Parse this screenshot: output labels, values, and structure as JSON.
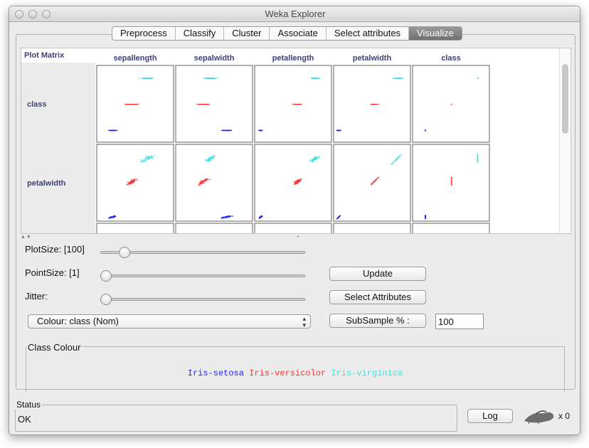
{
  "window": {
    "title": "Weka Explorer"
  },
  "tabs": [
    {
      "label": "Preprocess",
      "active": false
    },
    {
      "label": "Classify",
      "active": false
    },
    {
      "label": "Cluster",
      "active": false
    },
    {
      "label": "Associate",
      "active": false
    },
    {
      "label": "Select attributes",
      "active": false
    },
    {
      "label": "Visualize",
      "active": true
    }
  ],
  "plot_matrix": {
    "label": "Plot Matrix",
    "columns": [
      "sepallength",
      "sepalwidth",
      "petallength",
      "petalwidth",
      "class"
    ],
    "rows": [
      "class",
      "petalwidth"
    ]
  },
  "controls": {
    "plot_size_label": "PlotSize: [100]",
    "plot_size_value": 100,
    "point_size_label": "PointSize: [1]",
    "point_size_value": 1,
    "jitter_label": "Jitter:",
    "jitter_value": 0,
    "update_label": "Update",
    "select_attributes_label": "Select Attributes",
    "colour_select_value": "Colour: class (Nom)",
    "subsample_label": "SubSample % :",
    "subsample_value": "100"
  },
  "class_colour": {
    "title": "Class Colour",
    "classes": [
      {
        "name": "Iris-setosa",
        "color": "#2020ff"
      },
      {
        "name": "Iris-versicolor",
        "color": "#ff3030"
      },
      {
        "name": "Iris-virginica",
        "color": "#40e0e0"
      }
    ]
  },
  "status": {
    "title": "Status",
    "text": "OK",
    "log_label": "Log",
    "task_count": "x 0"
  }
}
